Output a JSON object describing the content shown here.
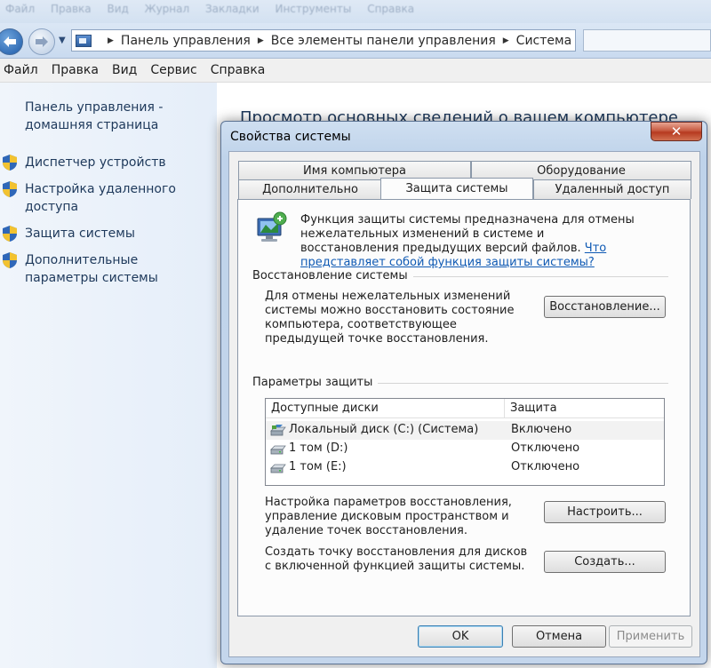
{
  "explorer": {
    "ghost_menu": [
      "Файл",
      "Правка",
      "Вид",
      "Журнал",
      "Закладки",
      "Инструменты",
      "Справка"
    ],
    "breadcrumbs": [
      "Панель управления",
      "Все элементы панели управления",
      "Система"
    ],
    "menu": [
      "Файл",
      "Правка",
      "Вид",
      "Сервис",
      "Справка"
    ],
    "left_pane": {
      "home": "Панель управления - домашняя страница",
      "tasks": [
        "Диспетчер устройств",
        "Настройка удаленного доступа",
        "Защита системы",
        "Дополнительные параметры системы"
      ]
    },
    "content_title": "Просмотр основных сведений о вашем компьютере"
  },
  "dialog": {
    "title": "Свойства системы",
    "close_glyph": "✕",
    "tabs_row1": [
      "Имя компьютера",
      "Оборудование"
    ],
    "tabs_row2": [
      "Дополнительно",
      "Защита системы",
      "Удаленный доступ"
    ],
    "active_tab": "Защита системы",
    "intro_text": "Функция защиты системы предназначена для отмены нежелательных изменений в системе и восстановления предыдущих версий файлов.",
    "intro_link": "Что представляет собой функция защиты системы?",
    "restore_group": {
      "title": "Восстановление системы",
      "text": "Для отмены нежелательных изменений системы можно восстановить состояние компьютера, соответствующее предыдущей точке восстановления.",
      "button": "Восстановление..."
    },
    "protection_group": {
      "title": "Параметры защиты",
      "columns": [
        "Доступные диски",
        "Защита"
      ],
      "drives": [
        {
          "name": "Локальный диск (C:) (Система)",
          "protection": "Включено",
          "icon": "system-drive-icon"
        },
        {
          "name": "1 том (D:)",
          "protection": "Отключено",
          "icon": "drive-icon"
        },
        {
          "name": "1 том (E:)",
          "protection": "Отключено",
          "icon": "drive-icon"
        }
      ],
      "configure_text": "Настройка параметров восстановления, управление дисковым пространством и удаление точек восстановления.",
      "configure_button": "Настроить...",
      "create_text": "Создать точку восстановления для дисков с включенной функцией защиты системы.",
      "create_button": "Создать..."
    },
    "buttons": {
      "ok": "OK",
      "cancel": "Отмена",
      "apply": "Применить"
    }
  }
}
